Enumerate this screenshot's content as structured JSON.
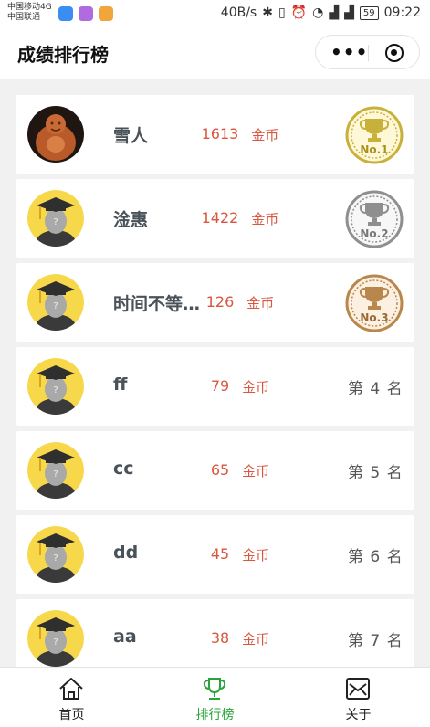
{
  "status_bar": {
    "carrier_1": "中国移动4G",
    "carrier_2": "中国联通",
    "speed": "40B/s",
    "battery": "59",
    "time": "09:22"
  },
  "header": {
    "title": "成绩排行榜"
  },
  "ranking": [
    {
      "name": "雪人",
      "score": "1613",
      "unit": "金币",
      "medal": "No.1",
      "medal_color": "#c8b13a"
    },
    {
      "name": "淦惠",
      "score": "1422",
      "unit": "金币",
      "medal": "No.2",
      "medal_color": "#8f8f8f"
    },
    {
      "name": "时间不等…",
      "score": "126",
      "unit": "金币",
      "medal": "No.3",
      "medal_color": "#b9874b"
    },
    {
      "name": "ff",
      "score": "79",
      "unit": "金币",
      "rank_label": "第 4 名"
    },
    {
      "name": "cc",
      "score": "65",
      "unit": "金币",
      "rank_label": "第 5 名"
    },
    {
      "name": "dd",
      "score": "45",
      "unit": "金币",
      "rank_label": "第 6 名"
    },
    {
      "name": "aa",
      "score": "38",
      "unit": "金币",
      "rank_label": "第 7 名"
    }
  ],
  "tabs": [
    {
      "label": "首页",
      "icon": "home-icon"
    },
    {
      "label": "排行榜",
      "icon": "trophy-icon",
      "active": true
    },
    {
      "label": "关于",
      "icon": "mail-icon"
    }
  ],
  "colors": {
    "score": "#d9573f",
    "active_tab": "#2aa33b",
    "avatar_yellow": "#f7d84a"
  }
}
